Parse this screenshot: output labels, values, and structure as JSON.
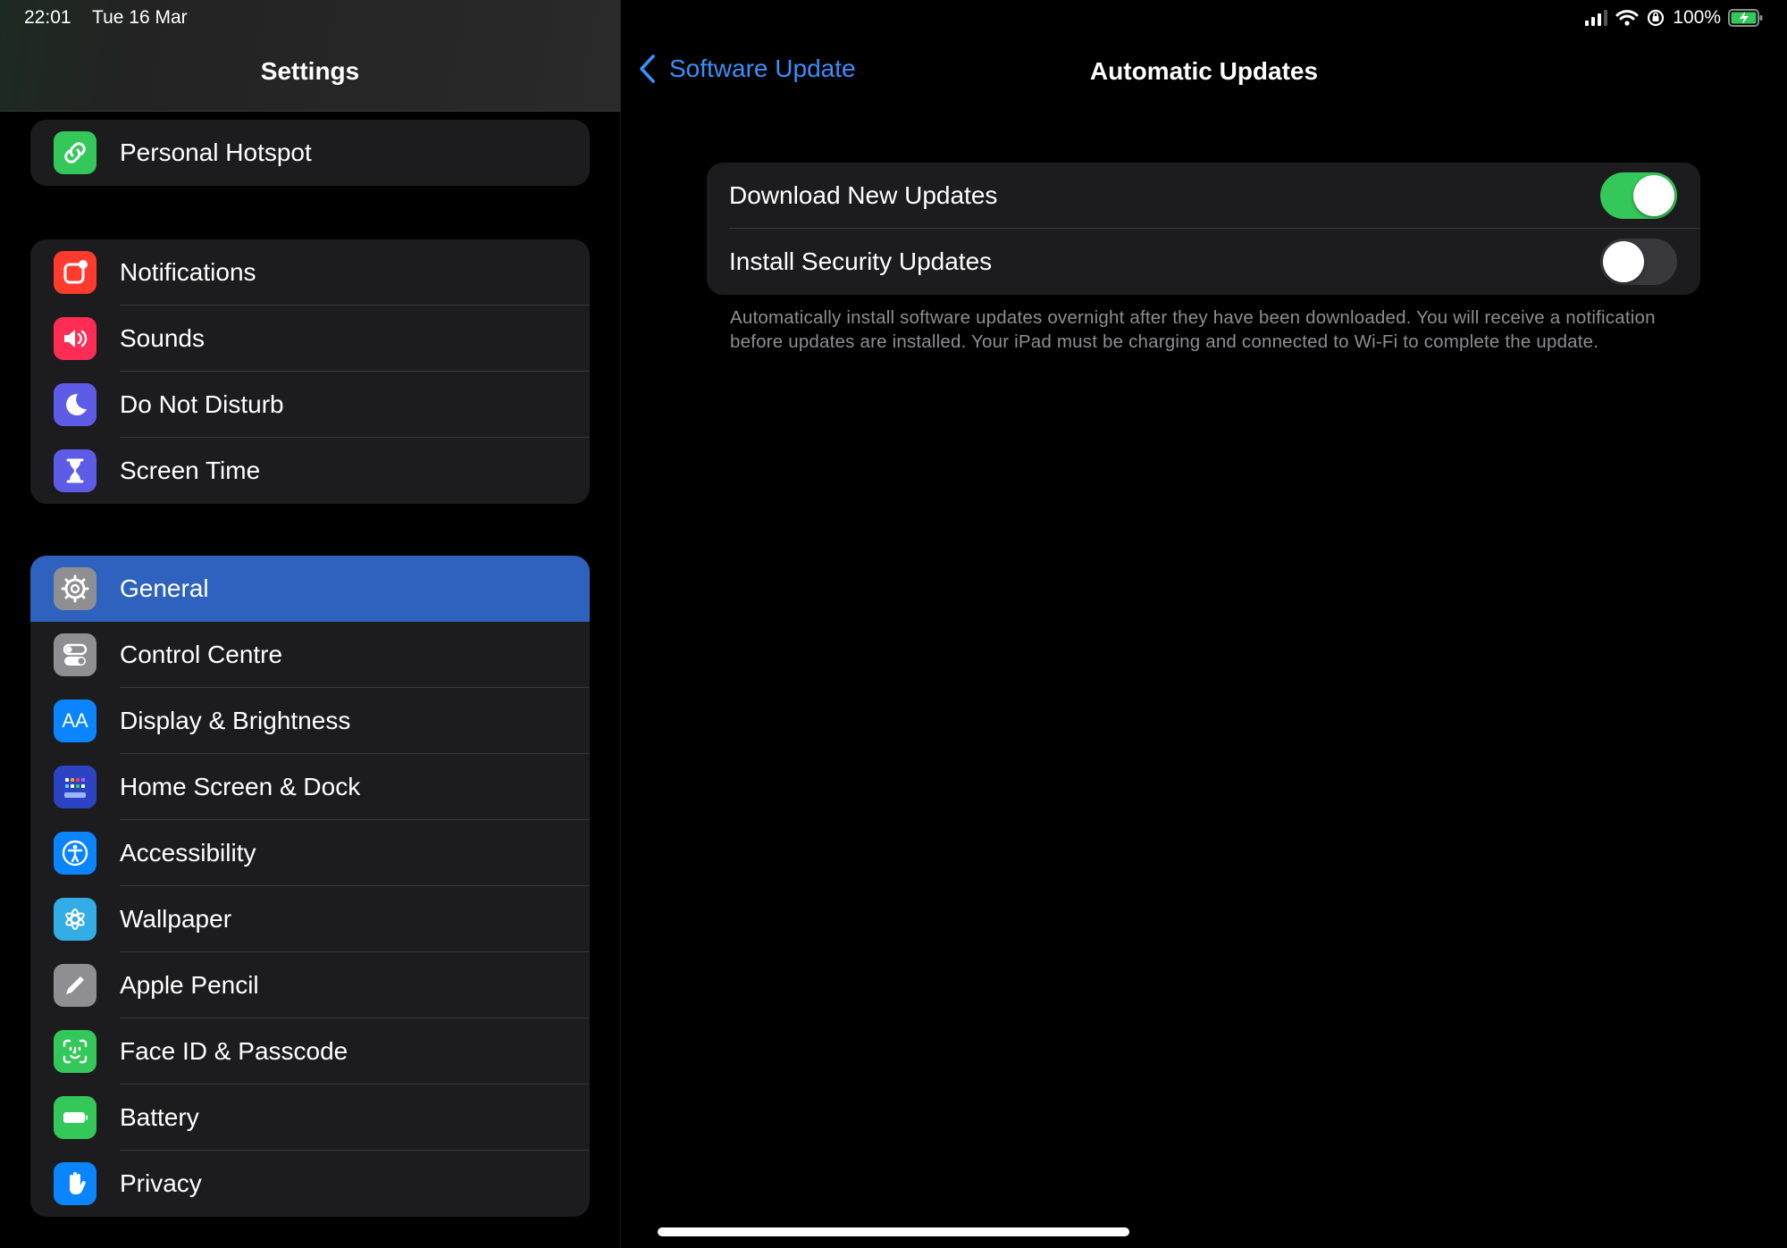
{
  "status_bar": {
    "time": "22:01",
    "date": "Tue 16 Mar",
    "battery_percent": "100%",
    "icons": [
      "cellular-signal-icon",
      "wifi-icon",
      "orientation-lock-icon",
      "battery-charging-icon"
    ]
  },
  "sidebar": {
    "title": "Settings",
    "groups": [
      {
        "items": [
          {
            "label": "Personal Hotspot",
            "icon": "personal-hotspot-icon",
            "color": "#34c759"
          }
        ]
      },
      {
        "items": [
          {
            "label": "Notifications",
            "icon": "notifications-icon",
            "color": "#ff3b30"
          },
          {
            "label": "Sounds",
            "icon": "sounds-icon",
            "color": "#ff2d55"
          },
          {
            "label": "Do Not Disturb",
            "icon": "moon-icon",
            "color": "#5e5ce6"
          },
          {
            "label": "Screen Time",
            "icon": "hourglass-icon",
            "color": "#5e5ce6"
          }
        ]
      },
      {
        "items": [
          {
            "label": "General",
            "icon": "gear-icon",
            "color": "#8e8e93",
            "selected": true
          },
          {
            "label": "Control Centre",
            "icon": "control-centre-icon",
            "color": "#8e8e93"
          },
          {
            "label": "Display & Brightness",
            "icon": "display-brightness-icon",
            "color": "#0a84ff",
            "glyph": "AA"
          },
          {
            "label": "Home Screen & Dock",
            "icon": "home-screen-icon",
            "color": "#2c44c4"
          },
          {
            "label": "Accessibility",
            "icon": "accessibility-icon",
            "color": "#0a84ff"
          },
          {
            "label": "Wallpaper",
            "icon": "wallpaper-icon",
            "color": "#32ade6"
          },
          {
            "label": "Apple Pencil",
            "icon": "pencil-icon",
            "color": "#8e8e93"
          },
          {
            "label": "Face ID & Passcode",
            "icon": "face-id-icon",
            "color": "#34c759"
          },
          {
            "label": "Battery",
            "icon": "battery-icon",
            "color": "#34c759"
          },
          {
            "label": "Privacy",
            "icon": "hand-icon",
            "color": "#0a84ff"
          }
        ]
      }
    ]
  },
  "detail": {
    "back_label": "Software Update",
    "title": "Automatic Updates",
    "settings": [
      {
        "label": "Download New Updates",
        "enabled": true
      },
      {
        "label": "Install Security Updates",
        "enabled": false
      }
    ],
    "footnote": "Automatically install software updates overnight after they have been downloaded. You will receive a notification before updates are installed. Your iPad must be charging and connected to Wi-Fi to complete the update."
  },
  "colors": {
    "accent": "#3a8ffb",
    "selected_row": "#2f62be",
    "toggle_on": "#34c759",
    "toggle_off": "#39393d"
  }
}
